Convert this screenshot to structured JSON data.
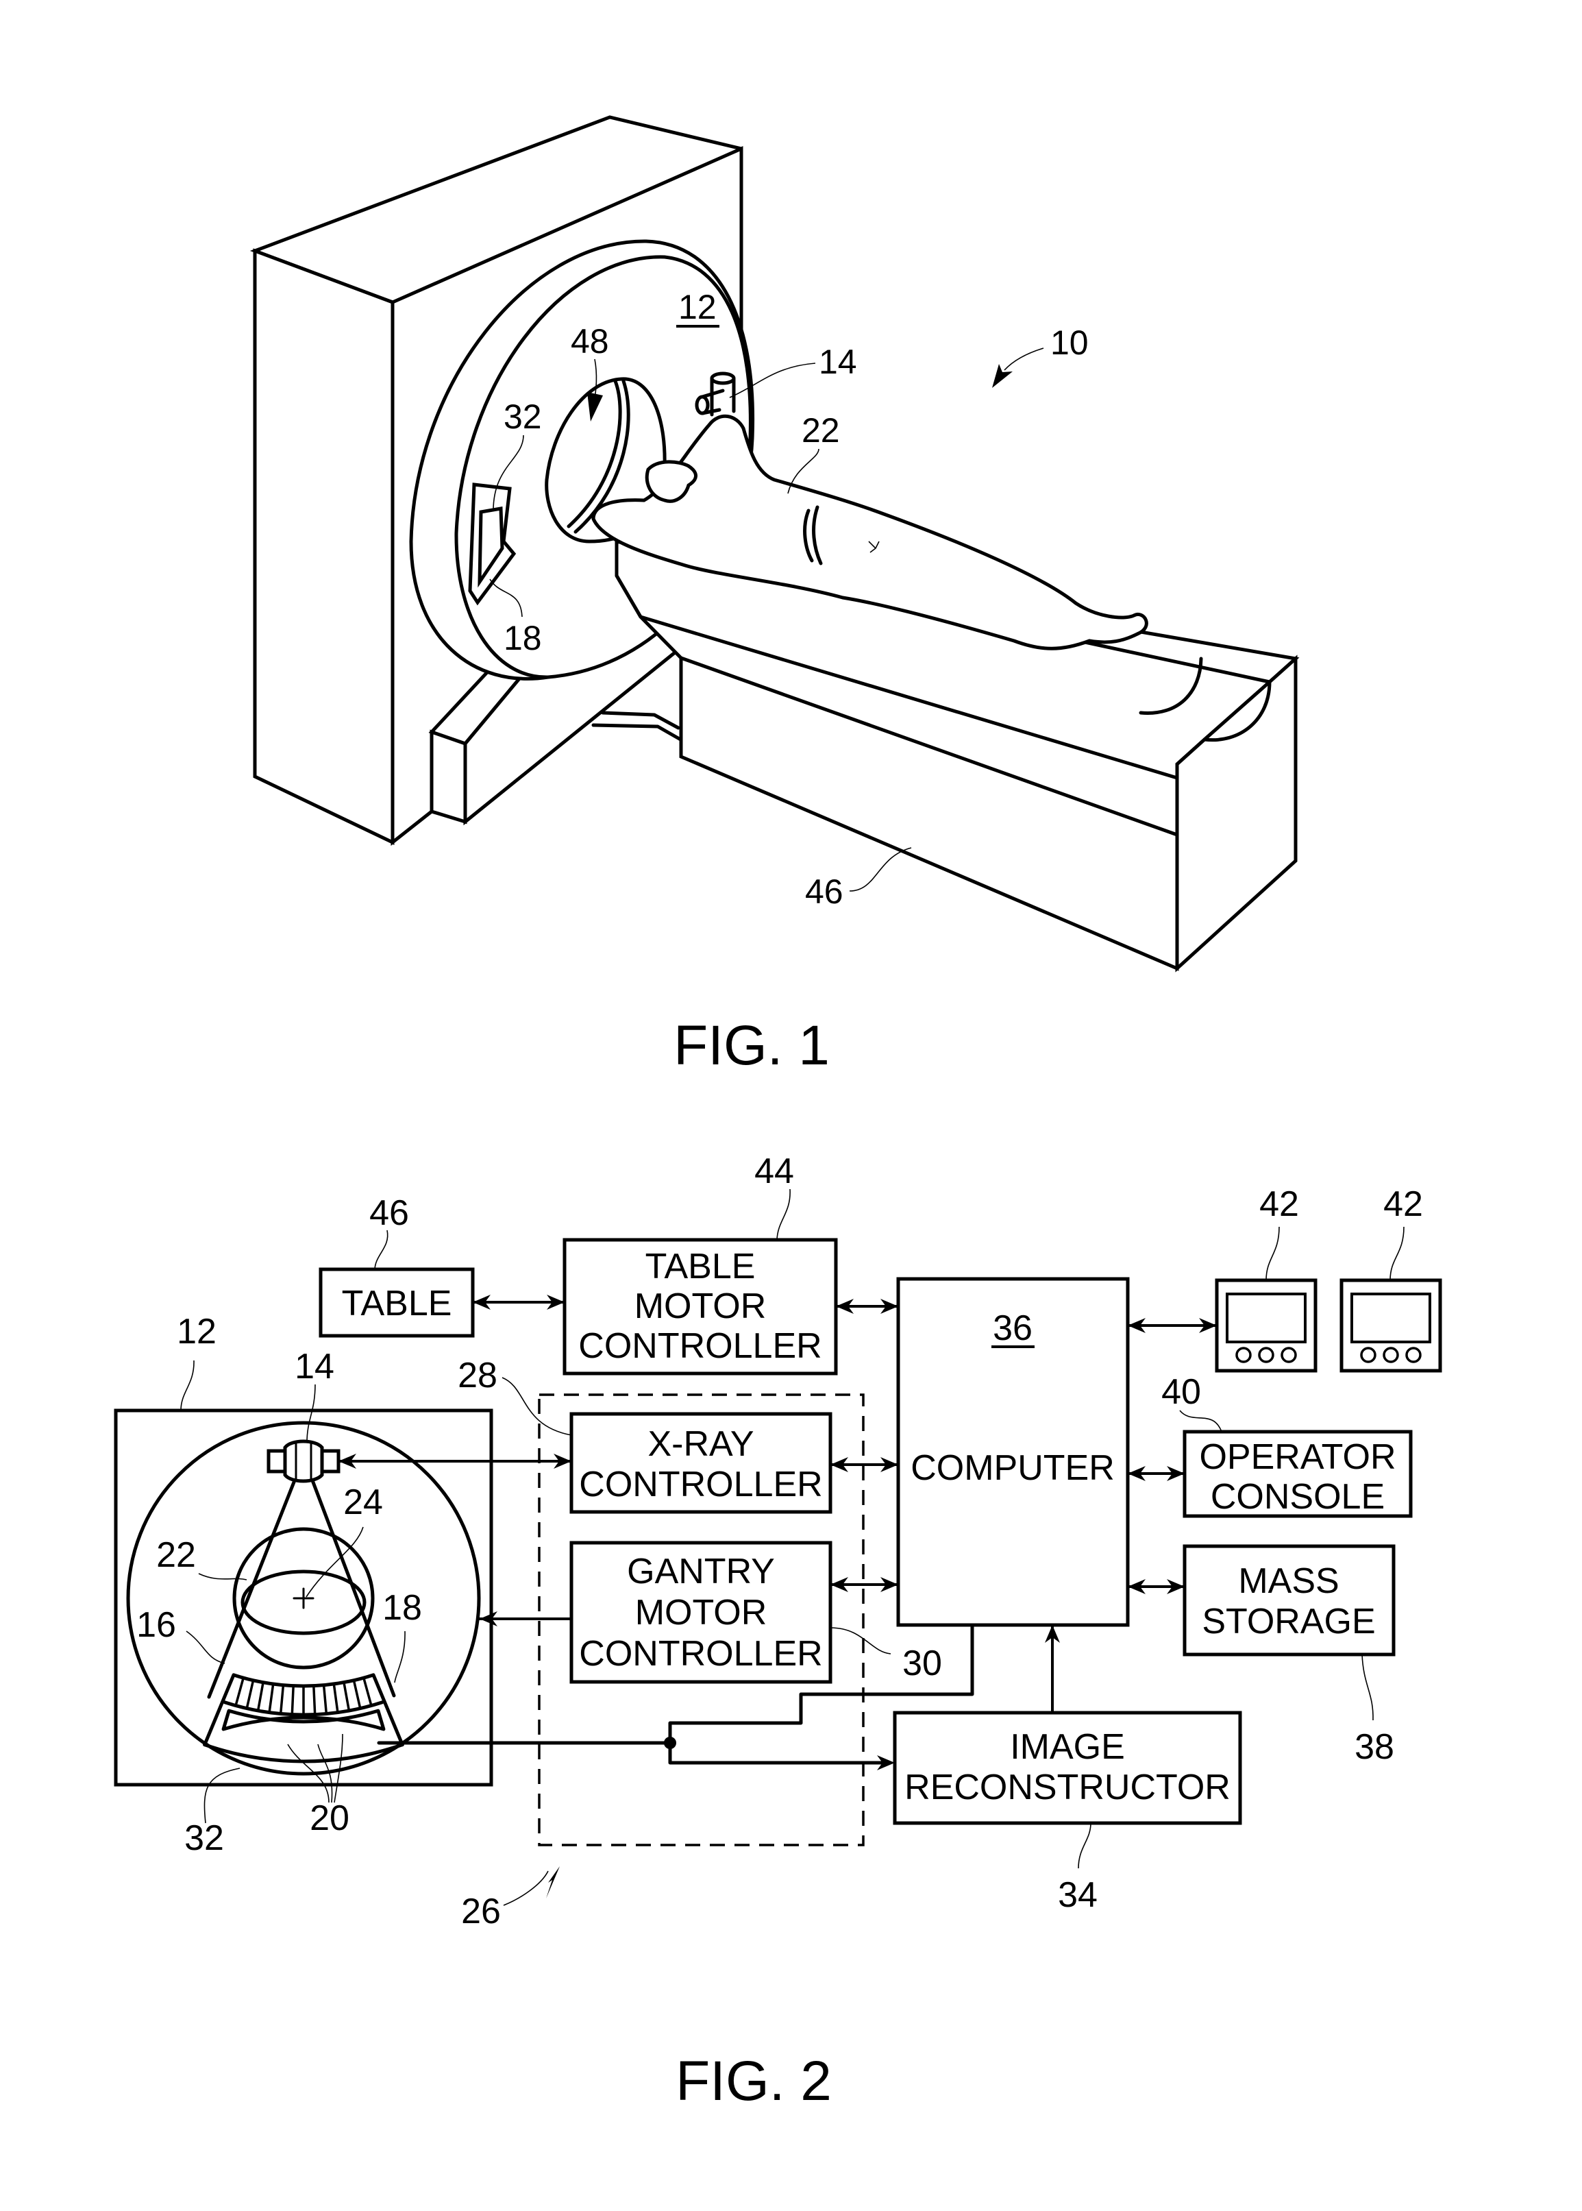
{
  "figure1": {
    "caption": "FIG. 1",
    "refs": {
      "system": "10",
      "gantry": "12",
      "xray_source": "14",
      "detector_array": "18",
      "patient": "22",
      "das": "32",
      "table": "46",
      "gantry_opening": "48"
    }
  },
  "figure2": {
    "caption": "FIG. 2",
    "blocks": {
      "table": {
        "label": "TABLE",
        "ref": "46"
      },
      "table_motor_controller": {
        "lines": [
          "TABLE",
          "MOTOR",
          "CONTROLLER"
        ],
        "ref": "44"
      },
      "xray_controller": {
        "lines": [
          "X-RAY",
          "CONTROLLER"
        ],
        "ref": "28"
      },
      "gantry_motor_controller": {
        "lines": [
          "GANTRY",
          "MOTOR",
          "CONTROLLER"
        ],
        "ref": "30"
      },
      "computer": {
        "label": "COMPUTER",
        "ref": "36"
      },
      "operator_console": {
        "lines": [
          "OPERATOR",
          "CONSOLE"
        ],
        "ref": "40"
      },
      "mass_storage": {
        "lines": [
          "MASS",
          "STORAGE"
        ],
        "ref": "38"
      },
      "image_reconstructor": {
        "lines": [
          "IMAGE",
          "RECONSTRUCTOR"
        ],
        "ref": "34"
      },
      "displays": {
        "ref": "42",
        "count": 2
      }
    },
    "refs": {
      "gantry": "12",
      "xray_source": "14",
      "xray_beam": "16",
      "detector_array": "18",
      "detector_elements": "20",
      "patient": "22",
      "center_of_rotation": "24",
      "control_mechanism": "26",
      "das": "32"
    }
  }
}
